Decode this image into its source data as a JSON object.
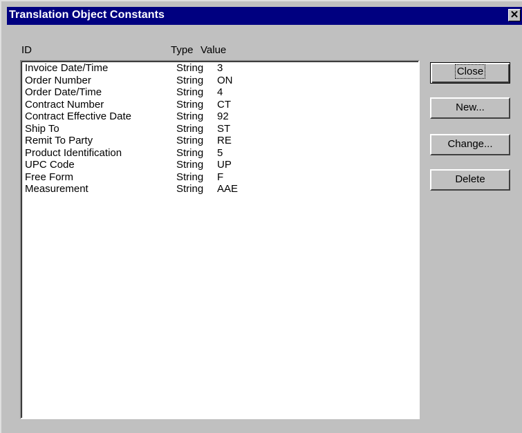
{
  "window": {
    "title": "Translation Object Constants"
  },
  "columns": {
    "id": "ID",
    "type": "Type",
    "value": "Value"
  },
  "rows": [
    {
      "id": "Invoice Date/Time",
      "type": "String",
      "value": "3"
    },
    {
      "id": "Order Number",
      "type": "String",
      "value": "ON"
    },
    {
      "id": "Order Date/Time",
      "type": "String",
      "value": "4"
    },
    {
      "id": "Contract Number",
      "type": "String",
      "value": "CT"
    },
    {
      "id": "Contract Effective Date",
      "type": "String",
      "value": "92"
    },
    {
      "id": "Ship To",
      "type": "String",
      "value": "ST"
    },
    {
      "id": "Remit To Party",
      "type": "String",
      "value": "RE"
    },
    {
      "id": "Product Identification",
      "type": "String",
      "value": "5"
    },
    {
      "id": "UPC Code",
      "type": "String",
      "value": "UP"
    },
    {
      "id": "Free Form",
      "type": "String",
      "value": "F"
    },
    {
      "id": "Measurement",
      "type": "String",
      "value": "AAE"
    }
  ],
  "buttons": {
    "close": "Close",
    "new": "New...",
    "change": "Change...",
    "delete": "Delete"
  },
  "icons": {
    "titlebar_close": "close-icon"
  },
  "colors": {
    "titlebar": "#000080",
    "face": "#c0c0c0"
  }
}
